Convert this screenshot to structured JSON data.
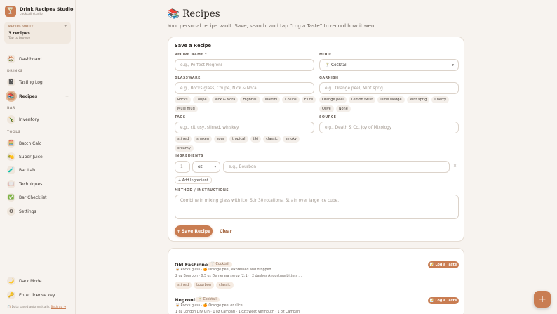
{
  "sidebar": {
    "brand_title": "Drink Recipes Studio",
    "brand_sub": "cocktail studio",
    "brand_icon": "cocktail-glass-icon",
    "vault_label": "RECIPE VAULT",
    "vault_count": "3 recipes",
    "vault_hint": "Tap to browse",
    "vault_plus": "+",
    "sections": {
      "drinks": "DRINKS",
      "bar": "BAR",
      "tools": "TOOLS"
    },
    "nav": {
      "dashboard": "Dashboard",
      "tasting_log": "Tasting Log",
      "recipes": "Recipes",
      "inventory": "Inventory",
      "batch_calc": "Batch Calc",
      "super_juice": "Super Juice",
      "bar_lab": "Bar Lab",
      "techniques": "Techniques",
      "bar_checklist": "Bar Checklist",
      "settings": "Settings",
      "dark_mode": "Dark Mode",
      "license": "Enter license key"
    },
    "recipes_plus": "+",
    "footnote": "Data saved automatically.",
    "footnote_link": "Back up →"
  },
  "header": {
    "title": "Recipes",
    "title_icon": "📚",
    "subtitle": "Your personal recipe vault. Save, search, and tap “Log a Taste” to record how it went."
  },
  "form": {
    "title": "Save a Recipe",
    "recipe_name_label": "RECIPE NAME *",
    "recipe_name_placeholder": "e.g., Perfect Negroni",
    "mode_label": "MODE",
    "mode_value": "🍸 Cocktail",
    "glassware_label": "GLASSWARE",
    "glassware_placeholder": "e.g., Rocks glass, Coupe, Nick & Nora",
    "glassware_chips": [
      "Rocks",
      "Coupe",
      "Nick & Nora",
      "Highball",
      "Martini",
      "Collins",
      "Flute",
      "Mule mug"
    ],
    "garnish_label": "GARNISH",
    "garnish_placeholder": "e.g., Orange peel, Mint sprig",
    "garnish_chips": [
      "Orange peel",
      "Lemon twist",
      "Lime wedge",
      "Mint sprig",
      "Cherry",
      "Olive",
      "None"
    ],
    "tags_label": "TAGS",
    "tags_placeholder": "e.g., citrusy, stirred, whiskey",
    "tag_chips": [
      "stirred",
      "shaken",
      "sour",
      "tropical",
      "tiki",
      "classic",
      "smoky",
      "creamy"
    ],
    "source_label": "SOURCE",
    "source_placeholder": "e.g., Death & Co, Joy of Mixology",
    "ingredients_label": "INGREDIENTS",
    "ing_qty_placeholder": "1",
    "ing_unit": "oz",
    "ing_name_placeholder": "e.g., Bourbon",
    "ing_remove": "×",
    "add_ingredient": "+ Add Ingredient",
    "method_label": "METHOD / INSTRUCTIONS",
    "method_placeholder": "Combine in mixing glass with ice. Stir 30 rotations. Strain over large ice cube.",
    "save_button": "+ Save Recipe",
    "clear_button": "Clear"
  },
  "recipes": [
    {
      "name": "Old Fashioned",
      "mode": "🍸 Cocktail",
      "meta": "🥃 Rocks glass · 🍊 Orange peel, expressed and dropped",
      "ingredients": "2 oz Bourbon · 0.5 oz Demerara syrup (2:1) · 2 dashes Angostura bitters ...",
      "tags": [
        "stirred",
        "bourbon",
        "classic"
      ],
      "log_button": "📝 Log a Taste"
    },
    {
      "name": "Negroni",
      "mode": "🍸 Cocktail",
      "meta": "🥃 Rocks glass · 🍊 Orange peel or slice",
      "ingredients": "1 oz London Dry Gin · 1 oz Campari · 1 oz Sweet Vermouth · 1 oz Campari",
      "log_button": "📝 Log a Taste"
    }
  ],
  "fab": "+",
  "colors": {
    "accent": "#c97d52",
    "background": "#f7f3ef"
  }
}
